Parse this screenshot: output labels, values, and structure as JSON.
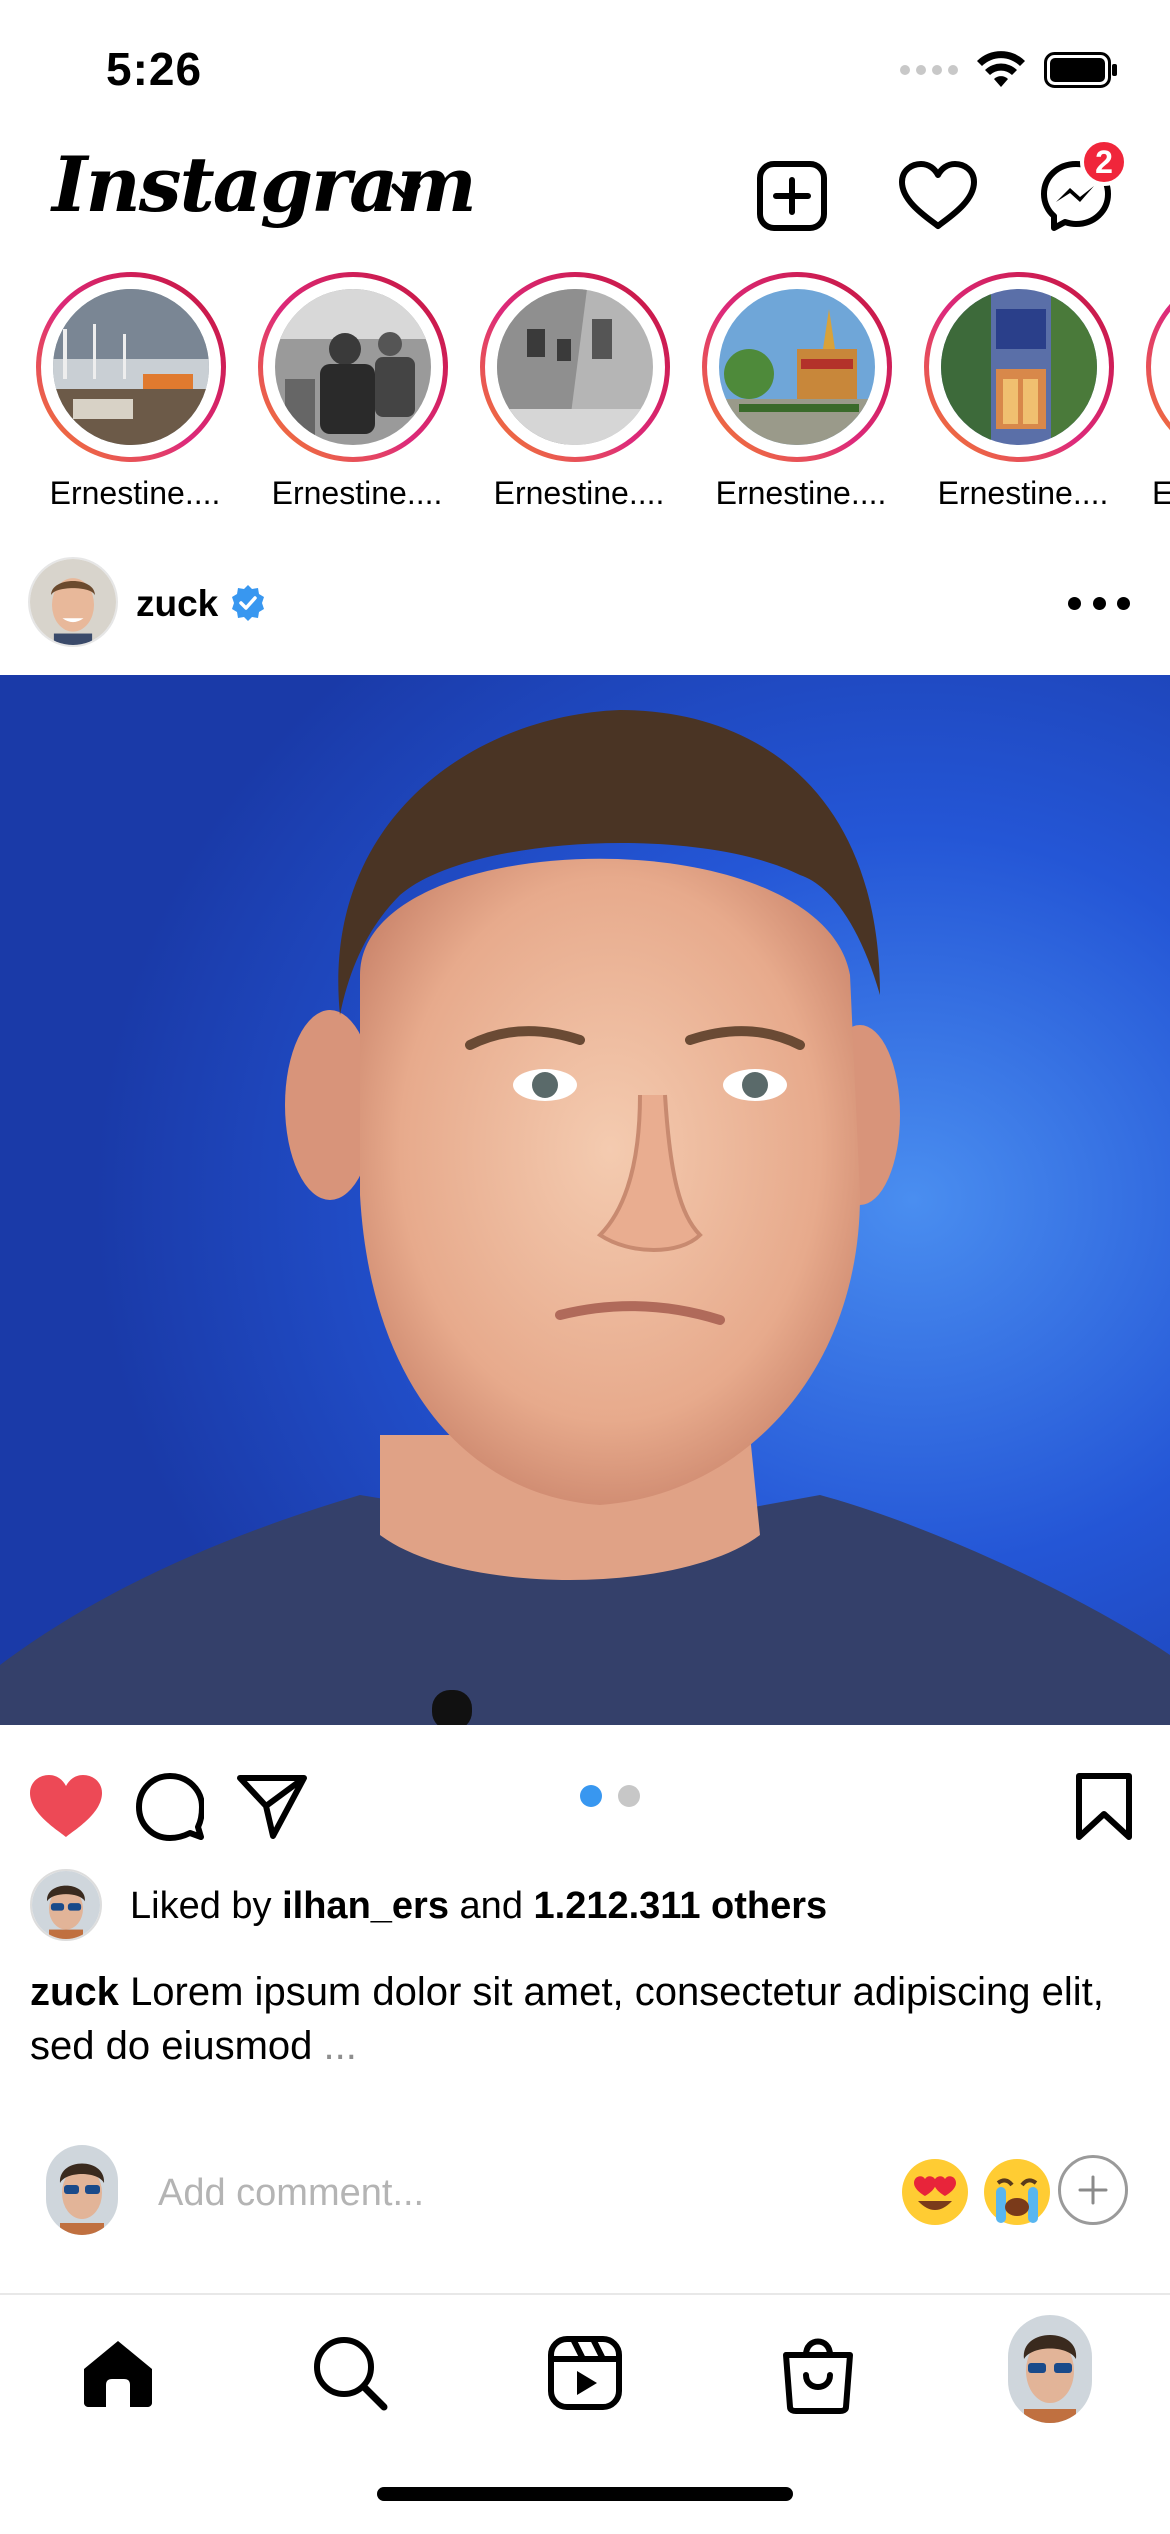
{
  "status_bar": {
    "time": "5:26"
  },
  "header": {
    "logo": "Instagram",
    "messenger_badge": "2"
  },
  "stories": [
    {
      "name": "Ernestine...."
    },
    {
      "name": "Ernestine...."
    },
    {
      "name": "Ernestine...."
    },
    {
      "name": "Ernestine...."
    },
    {
      "name": "Ernestine...."
    },
    {
      "name": "E"
    }
  ],
  "post": {
    "username": "zuck",
    "verified": true,
    "liked_by": "ilhan_ers",
    "likes_others": "1.212.311 others",
    "likes_prefix": "Liked by",
    "likes_and": "and",
    "caption_user": "zuck",
    "caption_text": "Lorem ipsum dolor sit amet, consectetur adipiscing elit, sed do eiusmod",
    "caption_more": "...",
    "carousel_pages": 2,
    "carousel_current": 1
  },
  "comment": {
    "placeholder": "Add comment...",
    "emojis": [
      "heart-eyes-emoji",
      "crying-emoji"
    ]
  },
  "colors": {
    "like_red": "#ed4956",
    "badge_red": "#f0263b",
    "dot_active": "#3897f0",
    "dot_inactive": "#c7c7c7",
    "verified_blue": "#3897f0",
    "image_blue": "#1e4bcc"
  },
  "icons": {
    "header": [
      "new-post-icon",
      "heart-icon",
      "messenger-icon"
    ],
    "actions": [
      "like-filled-icon",
      "comment-icon",
      "share-icon",
      "bookmark-icon"
    ],
    "tabs": [
      "home-icon",
      "search-icon",
      "reels-icon",
      "shop-icon",
      "profile-avatar"
    ]
  }
}
